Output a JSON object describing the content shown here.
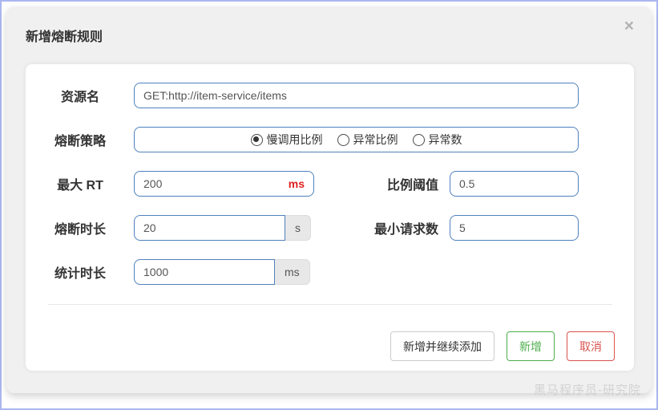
{
  "dialog": {
    "title": "新增熔断规则",
    "close_icon": "×"
  },
  "form": {
    "resource": {
      "label": "资源名",
      "value": "GET:http://item-service/items"
    },
    "strategy": {
      "label": "熔断策略",
      "options": [
        {
          "label": "慢调用比例",
          "selected": true
        },
        {
          "label": "异常比例",
          "selected": false
        },
        {
          "label": "异常数",
          "selected": false
        }
      ]
    },
    "max_rt": {
      "label": "最大 RT",
      "value": "200",
      "unit": "ms"
    },
    "ratio_threshold": {
      "label": "比例阈值",
      "value": "0.5"
    },
    "break_duration": {
      "label": "熔断时长",
      "value": "20",
      "unit": "s"
    },
    "min_requests": {
      "label": "最小请求数",
      "value": "5"
    },
    "stat_duration": {
      "label": "统计时长",
      "value": "1000",
      "unit": "ms"
    }
  },
  "footer": {
    "add_and_continue_label": "新增并继续添加",
    "add_label": "新增",
    "cancel_label": "取消"
  },
  "watermark": "黑马程序员-研究院",
  "colors": {
    "input_border_blue": "#4f81bd",
    "unit_red": "#e01f1f",
    "add_green": "#4cae4c",
    "cancel_red": "#d9534f",
    "modal_gray": "#f0f0f0",
    "page_border_blue": "#aab7ef"
  }
}
